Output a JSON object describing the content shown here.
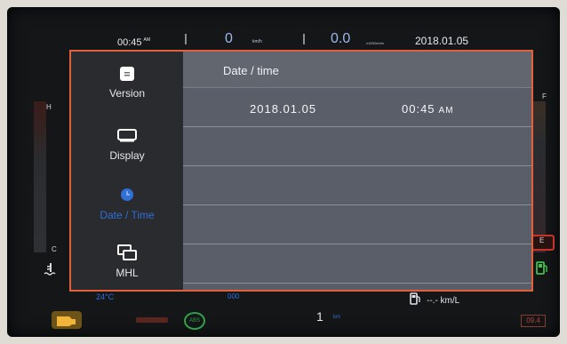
{
  "topbar": {
    "clock": "00:45",
    "clock_suffix": "AM",
    "speed": "0",
    "speed_unit": "km/h",
    "rpm": "0.0",
    "rpm_unit": "x1000r/min",
    "date": "2018.01.05"
  },
  "gauges": {
    "temp_high": "H",
    "temp_low": "C",
    "fuel_full": "F",
    "fuel_empty": "E"
  },
  "sidebar": {
    "items": [
      {
        "label": "Version",
        "icon": "version-icon",
        "active": false
      },
      {
        "label": "Display",
        "icon": "display-icon",
        "active": false
      },
      {
        "label": "Date / Time",
        "icon": "clock-icon",
        "active": true
      },
      {
        "label": "MHL",
        "icon": "mhl-icon",
        "active": false
      }
    ]
  },
  "content": {
    "title": "Date / time",
    "date_value": "2018.01.05",
    "time_value": "00:45",
    "time_suffix": "AM"
  },
  "bottombar": {
    "outside_temp": "24°C",
    "odo": "000",
    "fuel_economy": "--.- km/L",
    "trip": "1",
    "trip_unit": "km",
    "right_code": "09.4"
  },
  "colors": {
    "panel_border": "#e0613a",
    "accent_blue": "#2f6fd6",
    "content_bg": "#5a5e68"
  }
}
